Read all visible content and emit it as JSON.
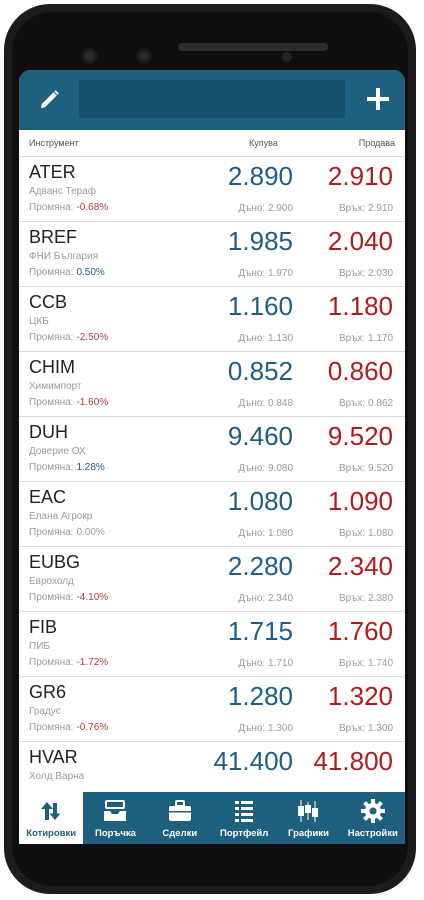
{
  "header": {
    "instrument": "Инструмент",
    "buy": "Купува",
    "sell": "Продава"
  },
  "search": {
    "value": ""
  },
  "rows": [
    {
      "symbol": "ATER",
      "name": "Адванс Тераф",
      "change_label": "Промяна:",
      "change": "-0.68%",
      "dir": "neg",
      "buy": "2.890",
      "sell": "2.910",
      "low": "Дъно: 2.900",
      "high": "Връх: 2.910"
    },
    {
      "symbol": "BREF",
      "name": "ФНИ България",
      "change_label": "Промяна:",
      "change": "0.50%",
      "dir": "pos",
      "buy": "1.985",
      "sell": "2.040",
      "low": "Дъно: 1.970",
      "high": "Връх: 2.030"
    },
    {
      "symbol": "CCB",
      "name": "ЦКБ",
      "change_label": "Промяна:",
      "change": "-2.50%",
      "dir": "neg",
      "buy": "1.160",
      "sell": "1.180",
      "low": "Дъно: 1.130",
      "high": "Връх: 1.170"
    },
    {
      "symbol": "CHIM",
      "name": "Химимпорт",
      "change_label": "Промяна:",
      "change": "-1.60%",
      "dir": "neg",
      "buy": "0.852",
      "sell": "0.860",
      "low": "Дъно: 0.848",
      "high": "Връх: 0.862"
    },
    {
      "symbol": "DUH",
      "name": "Доверие ОХ",
      "change_label": "Промяна:",
      "change": "1.28%",
      "dir": "pos",
      "buy": "9.460",
      "sell": "9.520",
      "low": "Дъно: 9.080",
      "high": "Връх: 9.520"
    },
    {
      "symbol": "EAC",
      "name": "Елана Агрокр",
      "change_label": "Промяна:",
      "change": "0.00%",
      "dir": "zero",
      "buy": "1.080",
      "sell": "1.090",
      "low": "Дъно: 1.080",
      "high": "Връх: 1.080"
    },
    {
      "symbol": "EUBG",
      "name": "Еврохолд",
      "change_label": "Промяна:",
      "change": "-4.10%",
      "dir": "neg",
      "buy": "2.280",
      "sell": "2.340",
      "low": "Дъно: 2.340",
      "high": "Връх: 2.380"
    },
    {
      "symbol": "FIB",
      "name": "ПИБ",
      "change_label": "Промяна:",
      "change": "-1.72%",
      "dir": "neg",
      "buy": "1.715",
      "sell": "1.760",
      "low": "Дъно: 1.710",
      "high": "Връх: 1.740"
    },
    {
      "symbol": "GR6",
      "name": "Градус",
      "change_label": "Промяна:",
      "change": "-0.76%",
      "dir": "neg",
      "buy": "1.280",
      "sell": "1.320",
      "low": "Дъно: 1.300",
      "high": "Връх: 1.300"
    },
    {
      "symbol": "HVAR",
      "name": "Холд Варна",
      "change_label": "",
      "change": "",
      "dir": "zero",
      "buy": "41.400",
      "sell": "41.800",
      "low": "",
      "high": ""
    }
  ],
  "nav": [
    {
      "label": "Котировки",
      "icon": "quotes-icon",
      "active": true
    },
    {
      "label": "Поръчка",
      "icon": "order-tray-icon",
      "active": false
    },
    {
      "label": "Сделки",
      "icon": "briefcase-icon",
      "active": false
    },
    {
      "label": "Портфейл",
      "icon": "portfolio-list-icon",
      "active": false
    },
    {
      "label": "Графики",
      "icon": "chart-candles-icon",
      "active": false
    },
    {
      "label": "Настройки",
      "icon": "gear-icon",
      "active": false
    }
  ],
  "colors": {
    "brand": "#1f607e",
    "buy": "#1f5d88",
    "sell": "#b01c1c",
    "negative_change": "#b73a3a",
    "positive_change": "#1f5d88"
  }
}
